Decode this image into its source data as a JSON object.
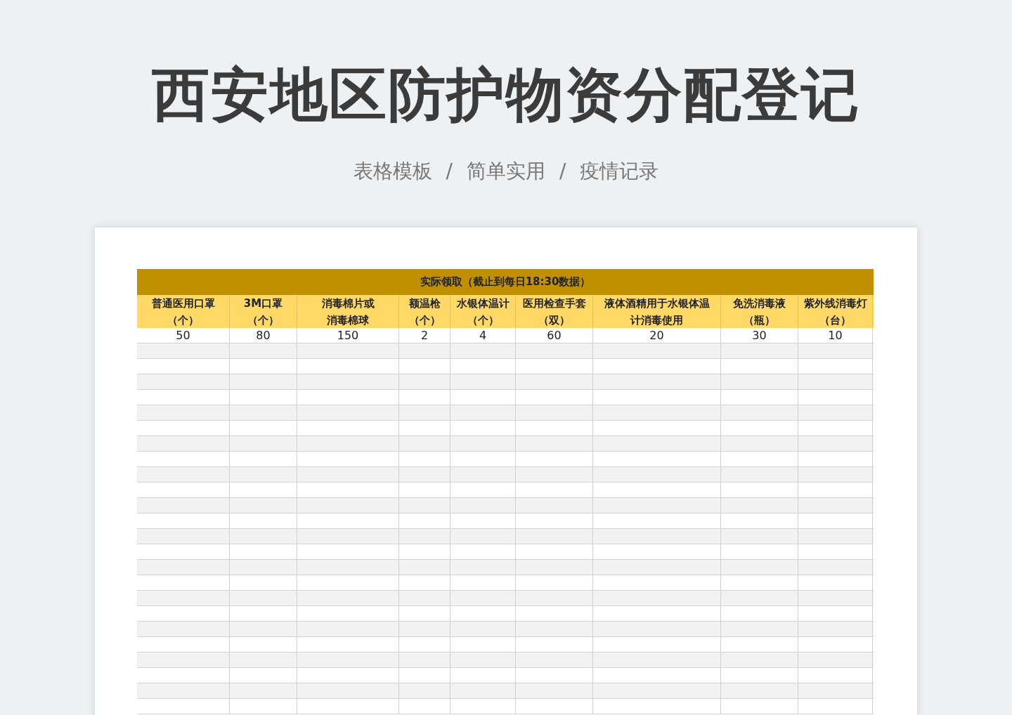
{
  "title": "西安地区防护物资分配登记",
  "subtitle": [
    "表格模板",
    "/",
    "简单实用",
    "/",
    "疫情记录"
  ],
  "table": {
    "group_header": "实际领取（截止到每日18:30数据）",
    "columns": [
      {
        "lines": [
          "普通医用口罩",
          "（个）"
        ]
      },
      {
        "lines": [
          "3M口罩",
          "（个）"
        ]
      },
      {
        "lines": [
          "消毒棉片或",
          "消毒棉球"
        ]
      },
      {
        "lines": [
          "额温枪",
          "（个）"
        ]
      },
      {
        "lines": [
          "水银体温计",
          "（个）"
        ]
      },
      {
        "lines": [
          "医用检查手套",
          "（双）"
        ]
      },
      {
        "lines": [
          "液体酒精用于水银体温",
          "计消毒使用"
        ]
      },
      {
        "lines": [
          "免洗消毒液",
          "（瓶）"
        ]
      },
      {
        "lines": [
          "紫外线消毒灯",
          "（台）"
        ]
      }
    ],
    "rows": [
      [
        "50",
        "80",
        "150",
        "2",
        "4",
        "60",
        "20",
        "30",
        "10"
      ]
    ]
  }
}
